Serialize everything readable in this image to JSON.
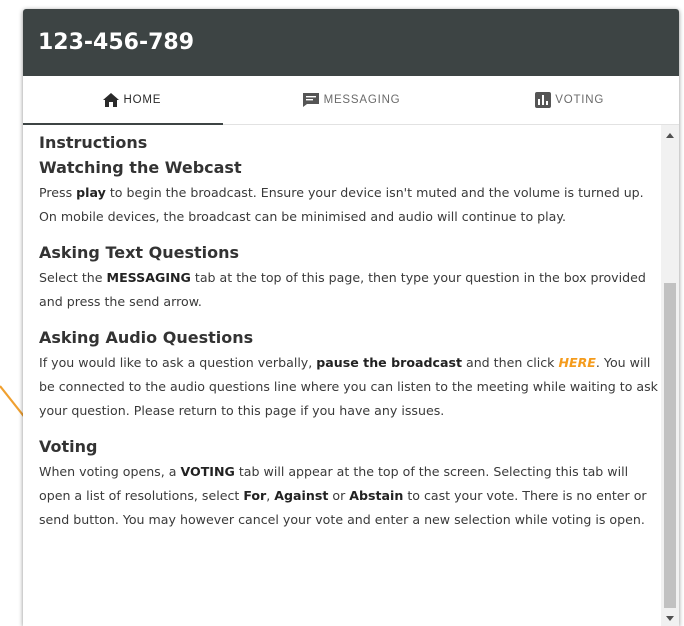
{
  "header": {
    "title": "123-456-789"
  },
  "tabs": [
    {
      "label": "HOME",
      "icon": "home-icon",
      "active": true
    },
    {
      "label": "MESSAGING",
      "icon": "chat-icon",
      "active": false
    },
    {
      "label": "VOTING",
      "icon": "bar-chart-icon",
      "active": false
    }
  ],
  "content": {
    "instructions_title": "Instructions",
    "webcast": {
      "title": "Watching the Webcast",
      "t1": "Press ",
      "b1": "play",
      "t2": " to begin the broadcast. Ensure your device isn't muted and the volume is turned up. On mobile devices, the broadcast can be minimised and audio will continue to play."
    },
    "text_questions": {
      "title": "Asking Text Questions",
      "t1": "Select the ",
      "b1": "MESSAGING",
      "t2": " tab at the top of this page, then type your question in the box provided and press the send arrow."
    },
    "audio_questions": {
      "title": "Asking Audio Questions",
      "t1": "If you would like to ask a question verbally, ",
      "b1": "pause the broadcast",
      "t2": " and then click ",
      "link": "HERE",
      "t3": ". You will be connected to the audio questions line where you can listen to the meeting while waiting to ask your question. Please return to this page if you have any issues."
    },
    "voting": {
      "title": "Voting",
      "t1": "When voting opens, a ",
      "b1": "VOTING",
      "t2": " tab will appear at the top of the screen. Selecting this tab will open a list of resolutions, select ",
      "b2": "For",
      "t3": ", ",
      "b3": "Against",
      "t4": " or ",
      "b4": "Abstain",
      "t5": " to cast your vote. There is no enter or send button. You may however cancel your vote and enter a new selection while voting is open."
    }
  },
  "colors": {
    "header_bg": "#3d4444",
    "link": "#f49b1c",
    "annotation_arrow": "#f0a030"
  }
}
